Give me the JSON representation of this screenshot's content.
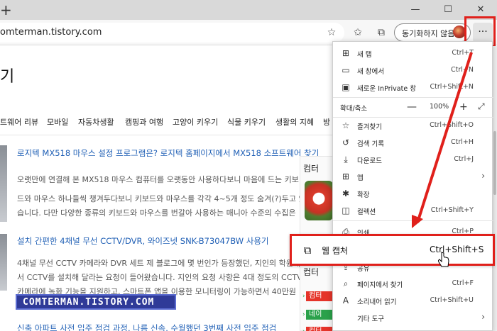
{
  "titlebar": {
    "new_tab_glyph": "+",
    "minimize_glyph": "—",
    "maximize_glyph": "☐",
    "close_glyph": "✕"
  },
  "addressbar": {
    "url": "omterman.tistory.com",
    "sync_label": "동기화하지 않음",
    "more_glyph": "···"
  },
  "page": {
    "blog_title": "기",
    "nav": [
      "트웨어 리뷰",
      "모바일",
      "자동차생활",
      "캠핑과 여행",
      "고양이 키우기",
      "식물 키우기",
      "생활의 지혜",
      "방"
    ],
    "posts": [
      {
        "title": "로지텍 MX518 마우스 설정 프로그램은? 로지텍 홈페이지에서 MX518 소프트웨어 찾기",
        "excerpt": [
          "오랫만에 연결해 본 MX518 마우스 컴퓨터를 오랫동안 사용하다보니 마음에 드는 키보",
          "드와 마우스 하나들씩 챙겨두다보니 키보드와 마우스를 각각 4~5개 정도 숨겨(?)두고 있",
          "습니다. 다만 다양한 종류의 키보드와 마우스를 번갈아 사용하는 매니아 수준의 수집은"
        ]
      },
      {
        "title": "설치 간편한 4채널 무선 CCTV/DVR, 와이즈넷 SNK-B73047BW 사용기",
        "excerpt": [
          "4채널 무선 CCTV 카메라와 DVR 세트 제 블로그에 몇 번인가 등장했던, 지인의 학원에",
          "서 CCTV를 설치해 달라는 요청이 들어왔습니다. 지인의 요청 사항은 4대 정도의 CCTV",
          "카메라에 녹화 기능을 지원하고, 스마트폰 앱을 이용한 모니터링이 가능하면서 40만원"
        ]
      },
      {
        "title": "신축 아파트 사전 입주 점검 과정, 나름 신속, 수월했던 3번째 사전 입주 점검",
        "excerpt": []
      }
    ],
    "side_head_1": "컴터",
    "side_head_2": "컴터",
    "side_tags": [
      "컴터",
      "네이",
      "컴터"
    ],
    "watermark": "COMTERMAN.TISTORY.COM"
  },
  "menu": {
    "items": [
      {
        "icon": "⊞",
        "icon_name": "new-tab-icon",
        "label": "새 탭",
        "shortcut": "Ctrl+T"
      },
      {
        "icon": "▭",
        "icon_name": "new-window-icon",
        "label": "새 창에서",
        "shortcut": "Ctrl+N"
      },
      {
        "icon": "▣",
        "icon_name": "inprivate-icon",
        "label": "새로운 InPrivate 창",
        "shortcut": "Ctrl+Shift+N"
      },
      {
        "icon": "",
        "icon_name": "zoom-icon",
        "label": "확대/축소",
        "shortcut": ""
      },
      {
        "icon": "☆",
        "icon_name": "favorites-icon",
        "label": "즐겨찾기",
        "shortcut": "Ctrl+Shift+O"
      },
      {
        "icon": "↺",
        "icon_name": "history-icon",
        "label": "검색 기록",
        "shortcut": "Ctrl+H"
      },
      {
        "icon": "⤓",
        "icon_name": "downloads-icon",
        "label": "다운로드",
        "shortcut": "Ctrl+J"
      },
      {
        "icon": "⊞",
        "icon_name": "apps-icon",
        "label": "앱",
        "shortcut": ""
      },
      {
        "icon": "✱",
        "icon_name": "extensions-icon",
        "label": "확장",
        "shortcut": ""
      },
      {
        "icon": "◫",
        "icon_name": "collections-icon",
        "label": "컬렉션",
        "shortcut": "Ctrl+Shift+Y"
      },
      {
        "icon": "⎙",
        "icon_name": "print-icon",
        "label": "인쇄",
        "shortcut": "Ctrl+P"
      },
      {
        "icon": "⇪",
        "icon_name": "share-icon",
        "label": "공유",
        "shortcut": ""
      },
      {
        "icon": "⌕",
        "icon_name": "find-icon",
        "label": "페이지에서 찾기",
        "shortcut": "Ctrl+F"
      },
      {
        "icon": "A",
        "icon_name": "read-aloud-icon",
        "label": "소리내어 읽기",
        "shortcut": "Ctrl+Shift+U"
      },
      {
        "icon": "",
        "icon_name": "more-tools-icon",
        "label": "기타 도구",
        "shortcut": ""
      }
    ],
    "zoom_value": "100%",
    "zoom_minus": "—",
    "zoom_plus": "+",
    "capture_label": "웹 캡처",
    "capture_shortcut": "Ctrl+Shift+S"
  },
  "colors": {
    "highlight": "#e0201b",
    "link": "#1f5fb5",
    "watermark_bg": "#2f3a98"
  }
}
